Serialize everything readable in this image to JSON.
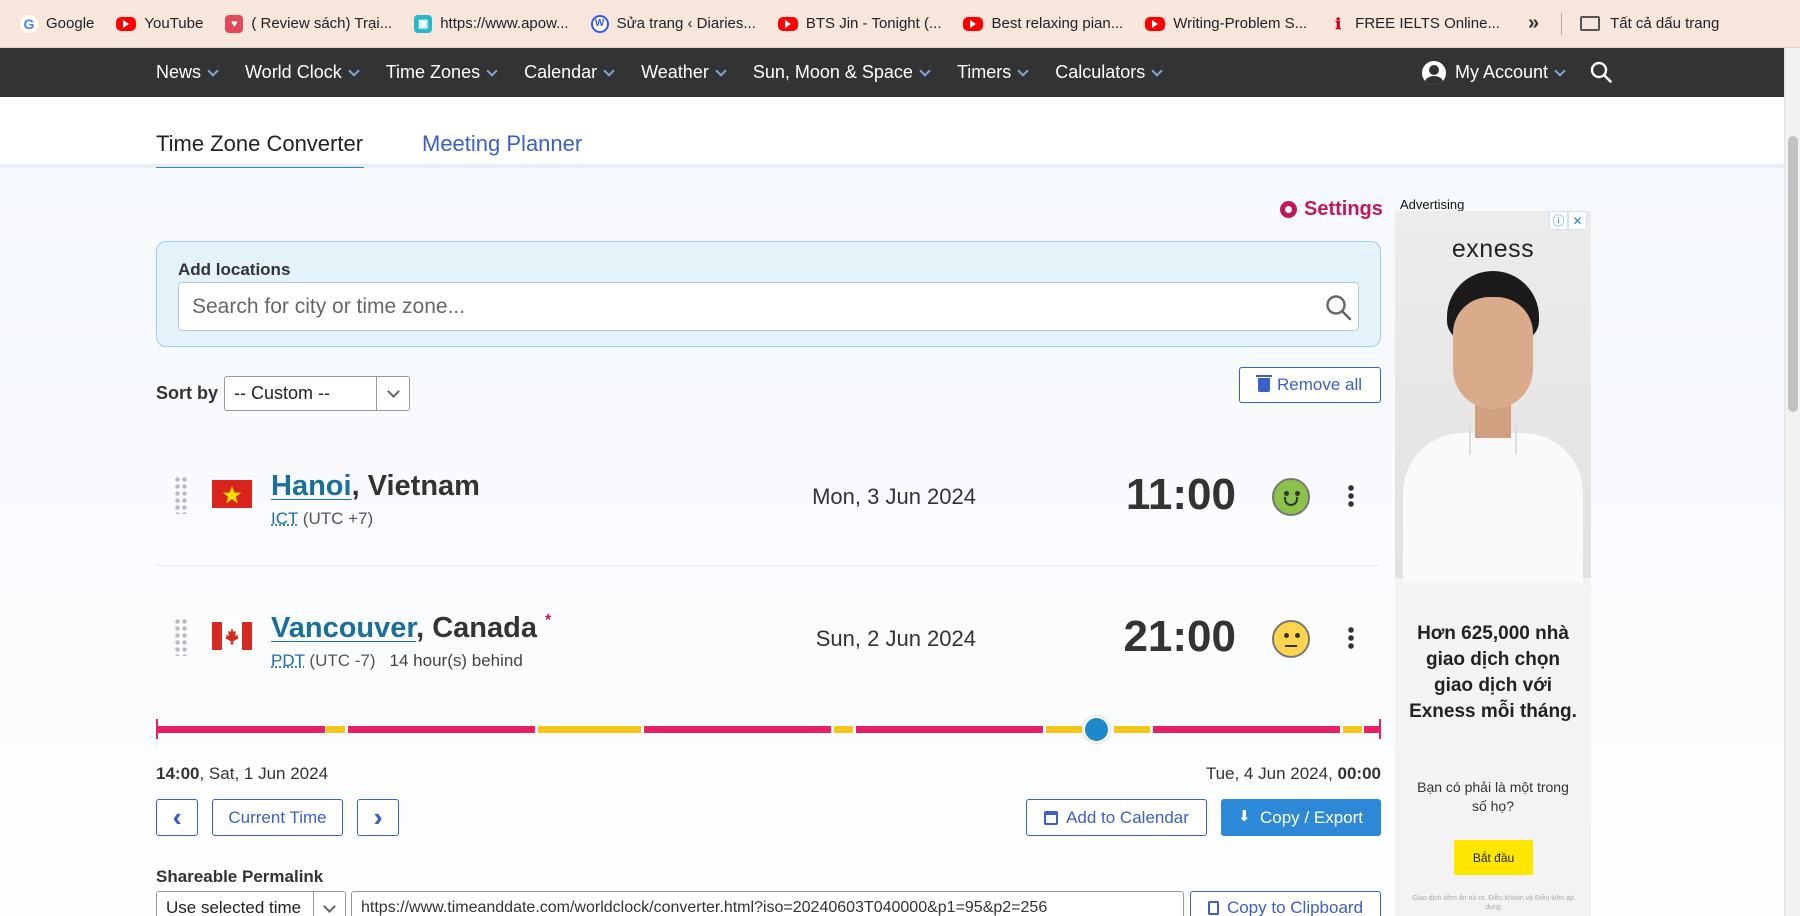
{
  "bookmarks": [
    {
      "label": "Google",
      "icon": "google-icon"
    },
    {
      "label": "YouTube",
      "icon": "youtube-icon"
    },
    {
      "label": "( Review sách) Trại...",
      "icon": "review-icon"
    },
    {
      "label": "https://www.apow...",
      "icon": "apowersoft-icon"
    },
    {
      "label": "Sửa trang ‹ Diaries...",
      "icon": "wordpress-icon"
    },
    {
      "label": "BTS Jin - Tonight (...",
      "icon": "youtube-icon"
    },
    {
      "label": "Best relaxing pian...",
      "icon": "youtube-icon"
    },
    {
      "label": "Writing-Problem S...",
      "icon": "youtube-icon"
    },
    {
      "label": "FREE IELTS Online...",
      "icon": "ielts-icon"
    }
  ],
  "bookmarks_more": "»",
  "bookmarks_folder": "Tất cả dấu trang",
  "nav": {
    "items": [
      "News",
      "World Clock",
      "Time Zones",
      "Calendar",
      "Weather",
      "Sun, Moon & Space",
      "Timers",
      "Calculators"
    ],
    "account": "My Account"
  },
  "tabs": {
    "active": "Time Zone Converter",
    "other": "Meeting Planner"
  },
  "settings_label": "Settings",
  "add_locations": {
    "label": "Add locations",
    "placeholder": "Search for city or time zone..."
  },
  "sort": {
    "label": "Sort by",
    "value": "-- Custom --"
  },
  "remove_all": "Remove all",
  "locations": [
    {
      "city": "Hanoi",
      "country": ", Vietnam",
      "tz_abbr": "ICT",
      "tz_offset": " (UTC +7)",
      "behind": "",
      "date": "Mon, 3 Jun 2024",
      "time": "11:00",
      "mood": "happy"
    },
    {
      "city": "Vancouver",
      "country": ", Canada",
      "marker": "*",
      "tz_abbr": "PDT",
      "tz_offset": " (UTC -7)",
      "behind": "14 hour(s) behind",
      "date": "Sun, 2 Jun 2024",
      "time": "21:00",
      "mood": "neutral"
    }
  ],
  "timeline": {
    "start_bold": "14:00",
    "start_rest": ", Sat, 1 Jun 2024",
    "end_rest": "Tue, 4 Jun 2024, ",
    "end_bold": "00:00",
    "colors": {
      "night": "#e91e63",
      "twilight": "#f5c518"
    }
  },
  "buttons": {
    "current_time": "Current Time",
    "add_to_calendar": "Add to Calendar",
    "copy_export": "Copy / Export",
    "copy_clipboard": "Copy to Clipboard"
  },
  "permalink": {
    "label": "Shareable Permalink",
    "select_value": "Use selected time",
    "url": "https://www.timeanddate.com/worldclock/converter.html?iso=20240603T040000&p1=95&p2=256"
  },
  "ad": {
    "label": "Advertising",
    "logo": "exness",
    "headline": "Hơn 625,000 nhà giao dịch chọn giao dịch với Exness mỗi tháng.",
    "subtext": "Bạn có phải là một trong số họ?",
    "cta": "Bắt đầu",
    "fine_print": "Giao dịch tiềm ẩn rủi ro. Điều khoản và Điều kiện áp dụng",
    "info_icon": "ⓘ",
    "close_icon": "✕"
  }
}
